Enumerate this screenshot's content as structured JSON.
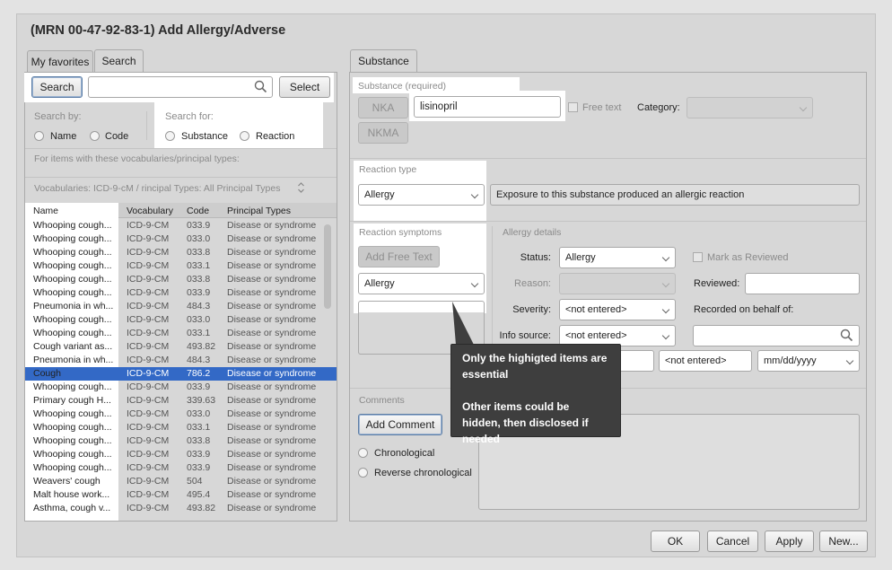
{
  "window": {
    "title": "(MRN 00-47-92-83-1) Add Allergy/Adverse"
  },
  "left": {
    "tabs": [
      "My favorites",
      "Search"
    ],
    "search_button": "Search",
    "search_value": "",
    "select_button": "Select",
    "search_by_label": "Search by:",
    "search_by_options": [
      "Name",
      "Code"
    ],
    "search_for_label": "Search for:",
    "search_for_options": [
      "Substance",
      "Reaction"
    ],
    "vocab_hint": "For items with these vocabularies/principal types:",
    "vocab_filter": "Vocabularies: ICD-9-cM / rincipal Types: All Principal Types",
    "columns": [
      "Name",
      "Vocabulary",
      "Code",
      "Principal Types"
    ],
    "rows": [
      {
        "name": "Whooping cough...",
        "vocab": "ICD-9-CM",
        "code": "033.9",
        "type": "Disease or syndrome"
      },
      {
        "name": "Whooping cough...",
        "vocab": "ICD-9-CM",
        "code": "033.0",
        "type": "Disease or syndrome"
      },
      {
        "name": "Whooping cough...",
        "vocab": "ICD-9-CM",
        "code": "033.8",
        "type": "Disease or syndrome"
      },
      {
        "name": "Whooping cough...",
        "vocab": "ICD-9-CM",
        "code": "033.1",
        "type": "Disease or syndrome"
      },
      {
        "name": "Whooping cough...",
        "vocab": "ICD-9-CM",
        "code": "033.8",
        "type": "Disease or syndrome"
      },
      {
        "name": "Whooping cough...",
        "vocab": "ICD-9-CM",
        "code": "033.9",
        "type": "Disease or syndrome"
      },
      {
        "name": "Pneumonia in wh...",
        "vocab": "ICD-9-CM",
        "code": "484.3",
        "type": "Disease or syndrome"
      },
      {
        "name": "Whooping cough...",
        "vocab": "ICD-9-CM",
        "code": "033.0",
        "type": "Disease or syndrome"
      },
      {
        "name": "Whooping cough...",
        "vocab": "ICD-9-CM",
        "code": "033.1",
        "type": "Disease or syndrome"
      },
      {
        "name": "Cough variant as...",
        "vocab": "ICD-9-CM",
        "code": "493.82",
        "type": "Disease or syndrome"
      },
      {
        "name": "Pneumonia in wh...",
        "vocab": "ICD-9-CM",
        "code": "484.3",
        "type": "Disease or syndrome"
      },
      {
        "name": "Cough",
        "vocab": "ICD-9-CM",
        "code": "786.2",
        "type": "Disease or syndrome"
      },
      {
        "name": "Whooping cough...",
        "vocab": "ICD-9-CM",
        "code": "033.9",
        "type": "Disease or syndrome"
      },
      {
        "name": "Primary cough H...",
        "vocab": "ICD-9-CM",
        "code": "339.63",
        "type": "Disease or syndrome"
      },
      {
        "name": "Whooping cough...",
        "vocab": "ICD-9-CM",
        "code": "033.0",
        "type": "Disease or syndrome"
      },
      {
        "name": "Whooping cough...",
        "vocab": "ICD-9-CM",
        "code": "033.1",
        "type": "Disease or syndrome"
      },
      {
        "name": "Whooping cough...",
        "vocab": "ICD-9-CM",
        "code": "033.8",
        "type": "Disease or syndrome"
      },
      {
        "name": "Whooping cough...",
        "vocab": "ICD-9-CM",
        "code": "033.9",
        "type": "Disease or syndrome"
      },
      {
        "name": "Whooping cough...",
        "vocab": "ICD-9-CM",
        "code": "033.9",
        "type": "Disease or syndrome"
      },
      {
        "name": "Weavers' cough",
        "vocab": "ICD-9-CM",
        "code": "504",
        "type": "Disease or syndrome"
      },
      {
        "name": "Malt house work...",
        "vocab": "ICD-9-CM",
        "code": "495.4",
        "type": "Disease or syndrome"
      },
      {
        "name": "Asthma, cough v...",
        "vocab": "ICD-9-CM",
        "code": "493.82",
        "type": "Disease or syndrome"
      }
    ],
    "selected_row": 11
  },
  "right": {
    "tab": "Substance",
    "substance_label": "Substance (required)",
    "nka_button": "NKA",
    "nkma_button": "NKMA",
    "substance_value": "lisinopril",
    "free_text_label": "Free text",
    "category_label": "Category:",
    "category_value": "",
    "reaction_type_label": "Reaction type",
    "reaction_type_value": "Allergy",
    "reaction_description": "Exposure to this substance produced an allergic reaction",
    "reaction_symptoms_label": "Reaction symptoms",
    "add_free_text_button": "Add Free Text",
    "symptoms_value": "Allergy",
    "allergy_details_label": "Allergy details",
    "status_label": "Status:",
    "status_value": "Allergy",
    "mark_reviewed_label": "Mark as Reviewed",
    "reason_label": "Reason:",
    "reason_value": "",
    "reviewed_label": "Reviewed:",
    "reviewed_value": "",
    "severity_label": "Severity:",
    "severity_value": "<not entered>",
    "recorded_label": "Recorded on behalf of:",
    "recorded_value": "",
    "info_source_label": "Info source:",
    "info_source_value": "<not entered>",
    "extra_value_1": "<not entered>",
    "date_placeholder": "mm/dd/yyyy",
    "comments_label": "Comments",
    "add_comment_button": "Add Comment",
    "order_options": [
      "Chronological",
      "Reverse chronological"
    ]
  },
  "footer": {
    "ok": "OK",
    "cancel": "Cancel",
    "apply": "Apply",
    "new": "New..."
  },
  "tooltip": {
    "line1": "Only the highigted items are essential",
    "line2": "Other items could be hidden, then disclosed if needed"
  }
}
